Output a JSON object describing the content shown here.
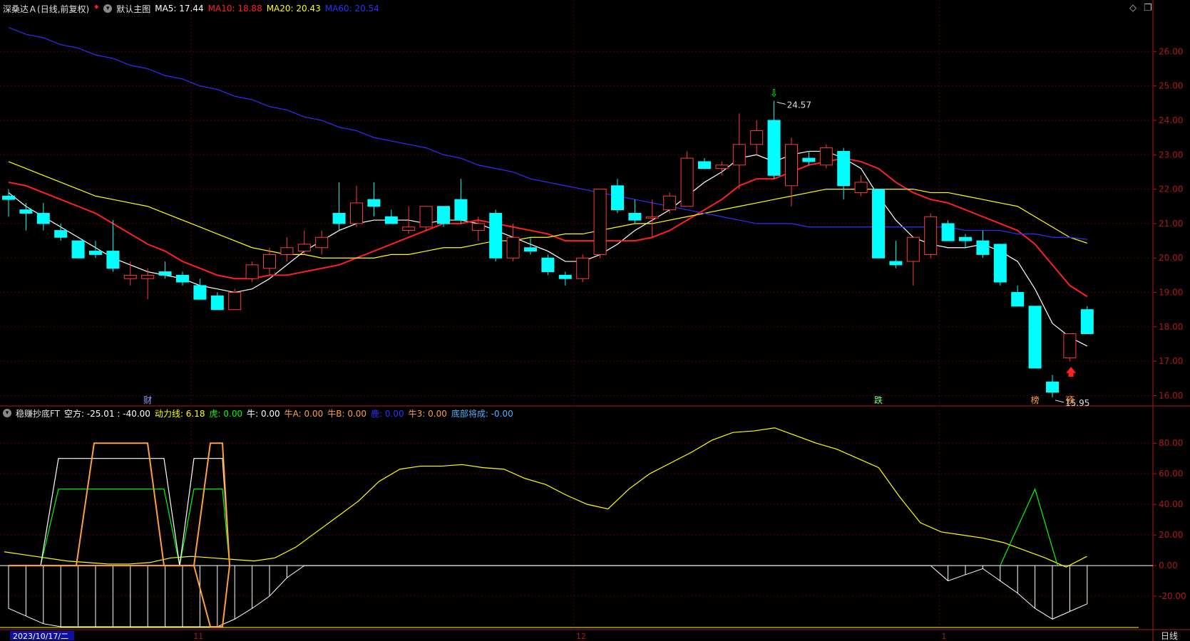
{
  "header": {
    "stock_name": "深桑达Ａ",
    "period": "(日线,前复权)",
    "main_chart_label": "默认主图",
    "ma_items": [
      {
        "text": "MA5: 17.44",
        "color": "#ffffff"
      },
      {
        "text": "MA10: 18.88",
        "color": "#ff2020"
      },
      {
        "text": "MA20: 20.43",
        "color": "#ffff00"
      },
      {
        "text": "MA60: 20.54",
        "color": "#2f2fff"
      }
    ]
  },
  "indicator_header": {
    "name": "稳赚抄底FT",
    "items": [
      {
        "text": "空方: -25.01 : -40.00",
        "color": "#ffffff"
      },
      {
        "text": "动力线: 6.18",
        "color": "#ffff00"
      },
      {
        "text": "虎: 0.00",
        "color": "#00ff00"
      },
      {
        "text": "牛: 0.00",
        "color": "#ffffff"
      },
      {
        "text": "牛A: 0.00",
        "color": "#ffa040"
      },
      {
        "text": "牛B: 0.00",
        "color": "#ffa040"
      },
      {
        "text": "鹿: 0.00",
        "color": "#2f2fff"
      },
      {
        "text": "牛3: 0.00",
        "color": "#ffa040"
      },
      {
        "text": "底部将成: -0.00",
        "color": "#4fb0ff"
      }
    ]
  },
  "bottom": {
    "date_label": "2023/10/17/二",
    "month_labels": [
      {
        "text": "11",
        "index": 11
      },
      {
        "text": "12",
        "index": 33
      },
      {
        "text": "1",
        "index": 54
      }
    ],
    "period_button": "日线"
  },
  "chart_data": [
    {
      "type": "candlestick",
      "title": "深桑达Ａ (日线,前复权)",
      "ylim": [
        15.7,
        27
      ],
      "yticks": [
        16,
        17,
        18,
        19,
        20,
        21,
        22,
        23,
        24,
        25,
        26
      ],
      "ytick_labels": [
        "16.00",
        "17.00",
        "18.00",
        "19.00",
        "20.00",
        "21.00",
        "22.00",
        "23.00",
        "24.00",
        "25.00",
        "26.00"
      ],
      "candles": [
        {
          "o": 21.8,
          "h": 22.0,
          "l": 21.2,
          "c": 21.7
        },
        {
          "o": 21.4,
          "h": 21.6,
          "l": 20.8,
          "c": 21.3
        },
        {
          "o": 21.3,
          "h": 21.6,
          "l": 20.8,
          "c": 21.0
        },
        {
          "o": 20.8,
          "h": 21.0,
          "l": 20.5,
          "c": 20.6
        },
        {
          "o": 20.5,
          "h": 20.5,
          "l": 20.0,
          "c": 20.0
        },
        {
          "o": 20.2,
          "h": 20.5,
          "l": 20.0,
          "c": 20.1
        },
        {
          "o": 20.2,
          "h": 21.1,
          "l": 19.6,
          "c": 19.7
        },
        {
          "o": 19.4,
          "h": 19.9,
          "l": 19.2,
          "c": 19.5
        },
        {
          "o": 19.4,
          "h": 19.7,
          "l": 18.8,
          "c": 19.5
        },
        {
          "o": 19.6,
          "h": 19.9,
          "l": 19.4,
          "c": 19.5
        },
        {
          "o": 19.5,
          "h": 19.6,
          "l": 19.2,
          "c": 19.3
        },
        {
          "o": 19.2,
          "h": 19.4,
          "l": 18.8,
          "c": 18.8
        },
        {
          "o": 18.9,
          "h": 19.0,
          "l": 18.5,
          "c": 18.5
        },
        {
          "o": 18.5,
          "h": 19.1,
          "l": 18.5,
          "c": 19.0
        },
        {
          "o": 19.4,
          "h": 19.9,
          "l": 19.3,
          "c": 19.8
        },
        {
          "o": 19.7,
          "h": 20.3,
          "l": 19.5,
          "c": 20.1
        },
        {
          "o": 20.1,
          "h": 20.6,
          "l": 19.9,
          "c": 20.3
        },
        {
          "o": 20.2,
          "h": 20.8,
          "l": 20.1,
          "c": 20.4
        },
        {
          "o": 20.3,
          "h": 20.8,
          "l": 20.1,
          "c": 20.6
        },
        {
          "o": 21.3,
          "h": 22.2,
          "l": 20.8,
          "c": 21.0
        },
        {
          "o": 21.0,
          "h": 22.1,
          "l": 20.9,
          "c": 21.6
        },
        {
          "o": 21.7,
          "h": 22.2,
          "l": 21.2,
          "c": 21.5
        },
        {
          "o": 21.2,
          "h": 21.4,
          "l": 21.0,
          "c": 21.0
        },
        {
          "o": 20.8,
          "h": 21.5,
          "l": 20.7,
          "c": 20.9
        },
        {
          "o": 20.9,
          "h": 21.5,
          "l": 20.8,
          "c": 21.5
        },
        {
          "o": 21.5,
          "h": 21.5,
          "l": 20.9,
          "c": 21.0
        },
        {
          "o": 21.7,
          "h": 22.3,
          "l": 21.0,
          "c": 21.1
        },
        {
          "o": 20.8,
          "h": 21.2,
          "l": 20.5,
          "c": 21.0
        },
        {
          "o": 21.3,
          "h": 21.4,
          "l": 19.9,
          "c": 20.0
        },
        {
          "o": 20.0,
          "h": 21.0,
          "l": 19.9,
          "c": 20.6
        },
        {
          "o": 20.3,
          "h": 20.6,
          "l": 20.1,
          "c": 20.2
        },
        {
          "o": 20.0,
          "h": 20.1,
          "l": 19.5,
          "c": 19.6
        },
        {
          "o": 19.5,
          "h": 19.6,
          "l": 19.2,
          "c": 19.4
        },
        {
          "o": 19.4,
          "h": 20.1,
          "l": 19.3,
          "c": 20.0
        },
        {
          "o": 20.1,
          "h": 22.0,
          "l": 20.0,
          "c": 22.0
        },
        {
          "o": 22.1,
          "h": 22.3,
          "l": 21.3,
          "c": 21.4
        },
        {
          "o": 21.3,
          "h": 21.7,
          "l": 21.0,
          "c": 21.1
        },
        {
          "o": 21.2,
          "h": 21.7,
          "l": 20.6,
          "c": 21.2
        },
        {
          "o": 21.4,
          "h": 21.9,
          "l": 21.3,
          "c": 21.8
        },
        {
          "o": 21.5,
          "h": 23.1,
          "l": 21.5,
          "c": 22.9
        },
        {
          "o": 22.8,
          "h": 22.9,
          "l": 22.6,
          "c": 22.6
        },
        {
          "o": 22.6,
          "h": 22.8,
          "l": 22.4,
          "c": 22.7
        },
        {
          "o": 22.7,
          "h": 24.2,
          "l": 22.0,
          "c": 23.3
        },
        {
          "o": 23.3,
          "h": 24.0,
          "l": 23.0,
          "c": 23.7
        },
        {
          "o": 24.0,
          "h": 24.57,
          "l": 22.3,
          "c": 22.4
        },
        {
          "o": 22.1,
          "h": 23.5,
          "l": 21.5,
          "c": 23.3
        },
        {
          "o": 22.9,
          "h": 23.1,
          "l": 22.7,
          "c": 22.8
        },
        {
          "o": 22.7,
          "h": 23.3,
          "l": 22.6,
          "c": 23.2
        },
        {
          "o": 23.1,
          "h": 23.2,
          "l": 21.7,
          "c": 22.1
        },
        {
          "o": 21.9,
          "h": 22.4,
          "l": 21.8,
          "c": 22.2
        },
        {
          "o": 22.0,
          "h": 22.0,
          "l": 20.0,
          "c": 20.0
        },
        {
          "o": 19.9,
          "h": 20.5,
          "l": 19.7,
          "c": 19.8
        },
        {
          "o": 19.9,
          "h": 20.4,
          "l": 19.2,
          "c": 20.6
        },
        {
          "o": 20.1,
          "h": 21.3,
          "l": 20.0,
          "c": 21.2
        },
        {
          "o": 21.0,
          "h": 21.1,
          "l": 20.5,
          "c": 20.5
        },
        {
          "o": 20.6,
          "h": 20.7,
          "l": 20.3,
          "c": 20.5
        },
        {
          "o": 20.5,
          "h": 20.8,
          "l": 20.0,
          "c": 20.1
        },
        {
          "o": 20.4,
          "h": 20.4,
          "l": 19.2,
          "c": 19.3
        },
        {
          "o": 19.0,
          "h": 19.2,
          "l": 18.6,
          "c": 18.6
        },
        {
          "o": 18.6,
          "h": 18.6,
          "l": 16.8,
          "c": 16.8
        },
        {
          "o": 16.4,
          "h": 16.6,
          "l": 15.95,
          "c": 16.1
        },
        {
          "o": 17.1,
          "h": 17.8,
          "l": 17.0,
          "c": 17.8
        },
        {
          "o": 18.5,
          "h": 18.6,
          "l": 17.8,
          "c": 17.8
        }
      ],
      "series": [
        {
          "name": "MA5",
          "color": "#ffffff",
          "values": [
            21.9,
            21.5,
            21.2,
            20.9,
            20.6,
            20.3,
            20.0,
            19.8,
            19.6,
            19.5,
            19.4,
            19.2,
            19.1,
            19.0,
            19.1,
            19.4,
            19.8,
            20.2,
            20.5,
            20.8,
            21.0,
            21.1,
            21.1,
            21.1,
            21.0,
            21.1,
            21.1,
            21.0,
            20.8,
            20.6,
            20.4,
            20.2,
            19.9,
            19.9,
            20.1,
            20.4,
            20.8,
            21.1,
            21.4,
            21.8,
            22.2,
            22.5,
            22.9,
            23.0,
            22.8,
            23.0,
            23.1,
            23.1,
            22.9,
            22.6,
            21.8,
            21.1,
            20.6,
            20.4,
            20.3,
            20.3,
            20.4,
            20.2,
            19.9,
            19.1,
            18.1,
            17.7,
            17.44
          ]
        },
        {
          "name": "MA10",
          "color": "#ff2020",
          "values": [
            22.2,
            22.1,
            21.9,
            21.7,
            21.5,
            21.3,
            21.0,
            20.7,
            20.4,
            20.2,
            19.9,
            19.7,
            19.5,
            19.4,
            19.4,
            19.5,
            19.5,
            19.6,
            19.7,
            19.8,
            20.0,
            20.2,
            20.4,
            20.6,
            20.8,
            21.0,
            21.0,
            21.1,
            21.0,
            20.9,
            20.8,
            20.7,
            20.5,
            20.5,
            20.5,
            20.5,
            20.5,
            20.6,
            20.8,
            21.1,
            21.4,
            21.7,
            22.1,
            22.3,
            22.3,
            22.5,
            22.7,
            22.8,
            22.9,
            22.8,
            22.6,
            22.2,
            21.9,
            21.7,
            21.6,
            21.4,
            21.2,
            21.0,
            20.8,
            20.4,
            19.8,
            19.2,
            18.88
          ]
        },
        {
          "name": "MA20",
          "color": "#ffff00",
          "values": [
            22.8,
            22.6,
            22.4,
            22.2,
            22.0,
            21.8,
            21.7,
            21.6,
            21.5,
            21.3,
            21.1,
            20.9,
            20.7,
            20.5,
            20.3,
            20.2,
            20.1,
            20.1,
            20.0,
            20.0,
            20.0,
            20.0,
            20.1,
            20.1,
            20.2,
            20.3,
            20.3,
            20.4,
            20.5,
            20.5,
            20.6,
            20.6,
            20.7,
            20.7,
            20.8,
            20.9,
            21.0,
            21.0,
            21.1,
            21.2,
            21.3,
            21.4,
            21.5,
            21.6,
            21.7,
            21.8,
            21.9,
            22.0,
            22.0,
            22.0,
            22.0,
            22.0,
            22.0,
            21.9,
            21.9,
            21.8,
            21.7,
            21.6,
            21.5,
            21.2,
            20.9,
            20.6,
            20.43
          ]
        },
        {
          "name": "MA60",
          "color": "#2f2fff",
          "values": [
            26.7,
            26.5,
            26.4,
            26.2,
            26.1,
            25.9,
            25.8,
            25.6,
            25.5,
            25.3,
            25.2,
            25.0,
            24.9,
            24.7,
            24.6,
            24.4,
            24.3,
            24.1,
            24.0,
            23.8,
            23.7,
            23.5,
            23.4,
            23.3,
            23.2,
            23.0,
            22.9,
            22.7,
            22.6,
            22.5,
            22.3,
            22.2,
            22.1,
            22.0,
            21.9,
            21.8,
            21.7,
            21.6,
            21.5,
            21.4,
            21.3,
            21.2,
            21.1,
            21.0,
            21.0,
            21.0,
            20.9,
            20.9,
            20.9,
            20.9,
            20.9,
            20.9,
            20.9,
            20.9,
            20.9,
            20.8,
            20.8,
            20.8,
            20.7,
            20.7,
            20.6,
            20.6,
            20.54
          ]
        }
      ],
      "annotations": [
        {
          "text": "24.57",
          "index": 44,
          "value": 24.57
        },
        {
          "text": "15.95",
          "index": 60,
          "value": 15.95
        }
      ],
      "markers": [
        {
          "text": "财",
          "index": 8,
          "color": "#8fa8ff"
        },
        {
          "text": "跌",
          "index": 50,
          "color": "#7fff7f"
        },
        {
          "text": "榜",
          "index": 59,
          "color": "#ffa040"
        },
        {
          "text": "预",
          "index": 61,
          "color": "#ffa040"
        }
      ]
    },
    {
      "type": "line",
      "title": "稳赚抄底FT",
      "ylim": [
        -40,
        95
      ],
      "yticks": [
        -20,
        0,
        20,
        40,
        60,
        80
      ],
      "ytick_labels": [
        "-20.00",
        "0.00",
        "20.00",
        "40.00",
        "60.00",
        "80.00"
      ],
      "series": [
        {
          "name": "空方",
          "color": "#ffffff",
          "values": [
            -28,
            -33,
            -38,
            -40,
            -40,
            -40,
            -40,
            -40,
            -40,
            -40,
            -40,
            -40,
            -40,
            -35,
            -28,
            -20,
            -8,
            0,
            0,
            0,
            0,
            0,
            0,
            0,
            0,
            0,
            0,
            0,
            0,
            0,
            0,
            0,
            0,
            0,
            0,
            0,
            0,
            0,
            0,
            0,
            0,
            0,
            0,
            0,
            0,
            0,
            0,
            0,
            0,
            0,
            0,
            0,
            0,
            0,
            -10,
            -6,
            -2,
            -10,
            -18,
            -28,
            -35,
            -30,
            -25
          ]
        },
        {
          "name": "动力线",
          "color": "#ffff00",
          "values": [
            9,
            7,
            5,
            3,
            2,
            1,
            1,
            2,
            5,
            6,
            5,
            4,
            3,
            5,
            12,
            22,
            32,
            42,
            55,
            63,
            65,
            65,
            66,
            64,
            63,
            57,
            53,
            46,
            40,
            37,
            50,
            60,
            67,
            74,
            82,
            87,
            88,
            90,
            85,
            80,
            76,
            70,
            64,
            45,
            28,
            22,
            20,
            18,
            15,
            10,
            5,
            -1,
            6
          ]
        },
        {
          "name": "虎",
          "color": "#00ff00",
          "values": [
            0,
            0,
            50,
            50,
            50,
            50,
            50,
            50,
            50,
            0,
            50,
            50,
            50,
            0
          ]
        },
        {
          "name": "牛",
          "color": "#ffffff",
          "values": [
            0,
            0,
            70,
            70,
            70,
            70,
            70,
            70,
            70,
            0,
            70,
            70,
            70,
            0
          ]
        },
        {
          "name": "牛A",
          "color": "#ffa040",
          "values": [
            0,
            0,
            0,
            0,
            80,
            80,
            80,
            80,
            0,
            0,
            0,
            80,
            80,
            0
          ]
        },
        {
          "name": "牛B",
          "color": "#ffa040",
          "values": [
            0,
            0,
            0,
            0,
            0,
            0,
            0,
            0,
            0,
            0,
            0,
            -40,
            -40,
            0
          ]
        }
      ]
    }
  ]
}
